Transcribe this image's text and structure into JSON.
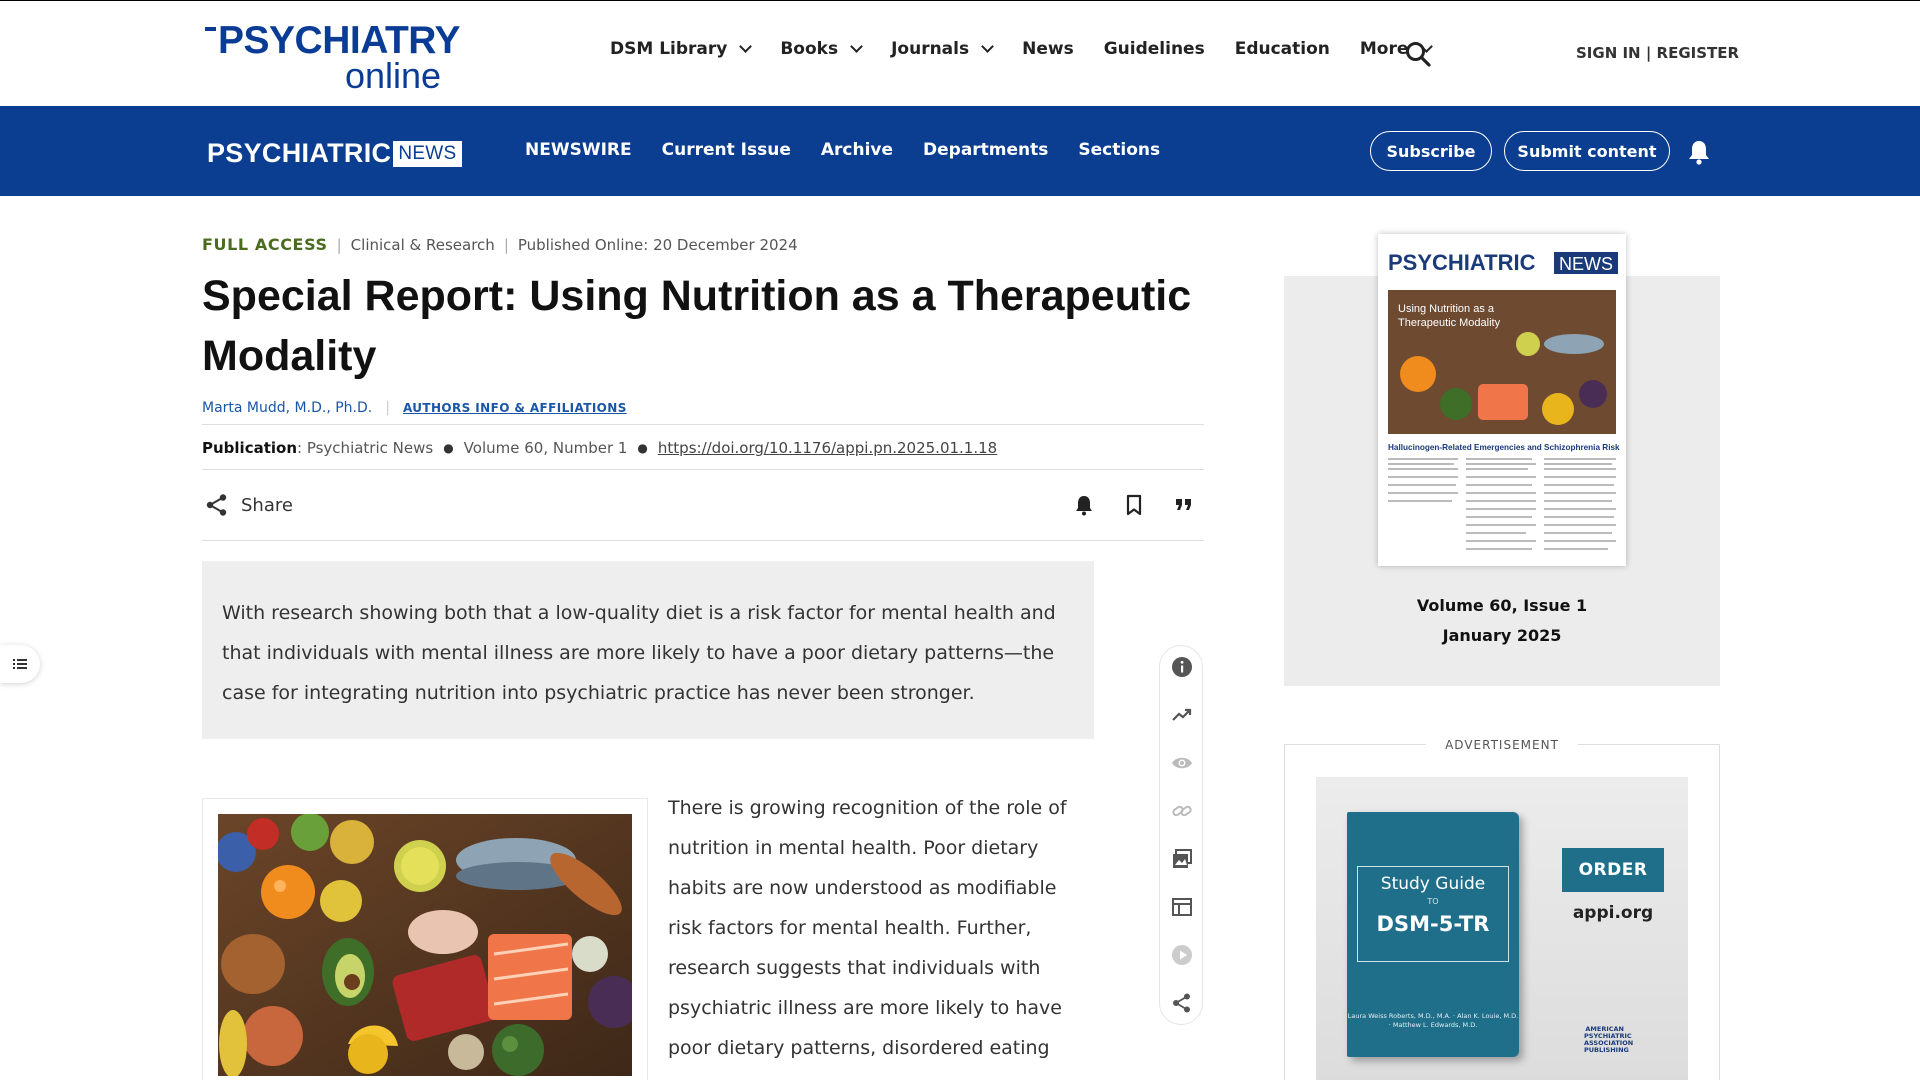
{
  "site": {
    "logo_line1": "PSYCHIATRY",
    "logo_line2": "online",
    "nav": [
      {
        "label": "DSM Library",
        "dropdown": true
      },
      {
        "label": "Books",
        "dropdown": true
      },
      {
        "label": "Journals",
        "dropdown": true
      },
      {
        "label": "News",
        "dropdown": false
      },
      {
        "label": "Guidelines",
        "dropdown": false
      },
      {
        "label": "Education",
        "dropdown": false
      },
      {
        "label": "More",
        "dropdown": true
      }
    ],
    "signin": "SIGN IN | REGISTER"
  },
  "pn": {
    "logo_main": "PSYCHIATRIC",
    "logo_box": "NEWS",
    "nav": [
      "NEWSWIRE",
      "Current Issue",
      "Archive",
      "Departments",
      "Sections"
    ],
    "subscribe": "Subscribe",
    "submit": "Submit content"
  },
  "article": {
    "access": "FULL ACCESS",
    "category": "Clinical & Research",
    "published": "Published Online: 20 December 2024",
    "title": "Special Report: Using Nutrition as a Therapeutic Modality",
    "author": "Marta Mudd, M.D., Ph.D.",
    "affiliations": "AUTHORS INFO & AFFILIATIONS",
    "publication_label": "Publication",
    "publication": ": Psychiatric News",
    "volume": "Volume 60, Number 1",
    "doi": "https://doi.org/10.1176/appi.pn.2025.01.1.18",
    "share": "Share",
    "abstract": "With research showing both that a low-quality diet is a risk factor for mental health and that individuals with mental illness are more likely to have a poor dietary patterns—the case for integrating nutrition into psychiatric practice has never been stronger.",
    "body": "There is growing recognition of the role of nutrition in mental health. Poor dietary habits are now understood as modifiable risk factors for mental health. Further, research suggests that individuals with psychiatric illness are more likely to have poor dietary patterns, disordered eating behaviors, and nutritional"
  },
  "sidebar": {
    "cover": {
      "masthead": "PSYCHIATRIC",
      "masthead_box": "NEWS",
      "headline": "Using Nutrition as a Therapeutic Modality",
      "subhead": "Hallucinogen-Related Emergencies and Schizophrenia Risk"
    },
    "caption_line1": "Volume 60, Issue 1",
    "caption_line2": "January 2025",
    "ad_label": "ADVERTISEMENT",
    "ad": {
      "book_title1": "Study Guide",
      "book_to": "TO",
      "book_title2": "DSM-5-TR",
      "authors": "Laura Weiss Roberts, M.D., M.A. · Alan K. Louie, M.D. · Matthew L. Edwards, M.D.",
      "order": "ORDER",
      "url": "appi.org",
      "publisher": "AMERICAN PSYCHIATRIC ASSOCIATION PUBLISHING"
    }
  },
  "icons": [
    "search-icon",
    "bell-icon",
    "bookmark-icon",
    "quote-icon",
    "share-icon",
    "info-icon",
    "trend-icon",
    "eye-icon",
    "link-icon",
    "image-icon",
    "table-icon",
    "play-icon",
    "list-icon"
  ],
  "colors": {
    "brand_blue": "#0b3d91",
    "access_green": "#4b6b1e",
    "link_blue": "#1a56a8"
  }
}
